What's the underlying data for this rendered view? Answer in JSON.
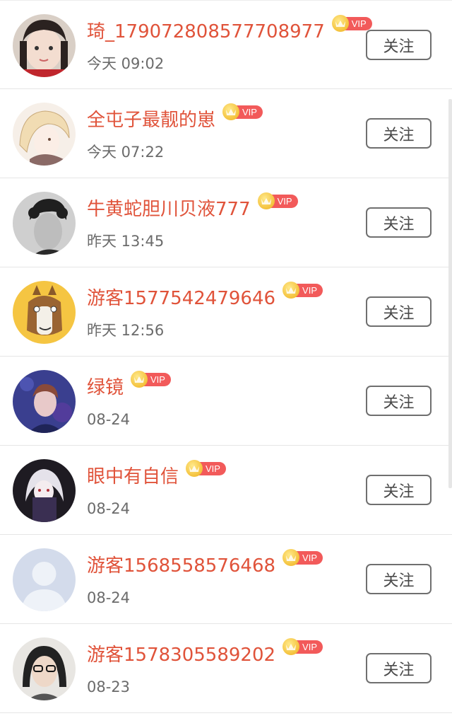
{
  "users": [
    {
      "name": "琦_17907280857770897​7",
      "time": "今天 09:02",
      "vip_label": "VIP",
      "follow_label": "关注",
      "avatar_icon": "girl-photo-avatar"
    },
    {
      "name": "全屯子最靓的崽",
      "time": "今天 07:22",
      "vip_label": "VIP",
      "follow_label": "关注",
      "avatar_icon": "anime-blonde-avatar"
    },
    {
      "name": "牛黄蛇胆川贝液777",
      "time": "昨天 13:45",
      "vip_label": "VIP",
      "follow_label": "关注",
      "avatar_icon": "curly-hair-man-avatar"
    },
    {
      "name": "游客1577542479646",
      "time": "昨天 12:56",
      "vip_label": "VIP",
      "follow_label": "关注",
      "avatar_icon": "cartoon-horse-avatar"
    },
    {
      "name": "绿镜",
      "time": "08-24",
      "vip_label": "VIP",
      "follow_label": "关注",
      "avatar_icon": "blue-portrait-avatar"
    },
    {
      "name": "眼中有自信",
      "time": "08-24",
      "vip_label": "VIP",
      "follow_label": "关注",
      "avatar_icon": "dark-anime-avatar"
    },
    {
      "name": "游客1568558576468",
      "time": "08-24",
      "vip_label": "VIP",
      "follow_label": "关注",
      "avatar_icon": "default-user-avatar"
    },
    {
      "name": "游客1578305589202",
      "time": "08-23",
      "vip_label": "VIP",
      "follow_label": "关注",
      "avatar_icon": "woman-glasses-avatar"
    }
  ],
  "colors": {
    "name": "#e0533a",
    "vip_tag": "#f25a5a",
    "vip_crown": "#f4c13b",
    "time": "#6b6b6b"
  }
}
